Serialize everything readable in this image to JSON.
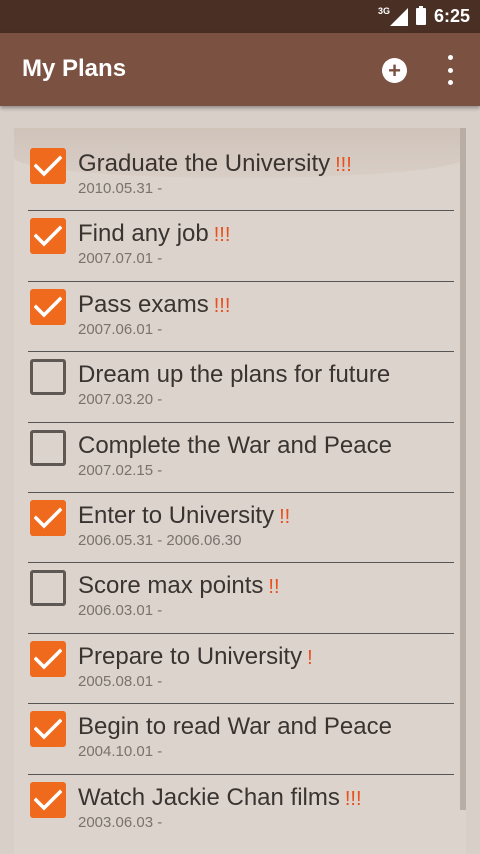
{
  "status_bar": {
    "network": "3G",
    "time": "6:25"
  },
  "app_bar": {
    "title": "My Plans"
  },
  "plans": [
    {
      "title": "Graduate the University",
      "priority": "!!!",
      "date": "2010.05.31 -",
      "checked": true
    },
    {
      "title": "Find any job",
      "priority": "!!!",
      "date": "2007.07.01 -",
      "checked": true
    },
    {
      "title": "Pass exams",
      "priority": "!!!",
      "date": "2007.06.01 -",
      "checked": true
    },
    {
      "title": "Dream up the plans for future",
      "priority": "",
      "date": "2007.03.20 -",
      "checked": false
    },
    {
      "title": "Complete the War and Peace",
      "priority": "",
      "date": "2007.02.15 -",
      "checked": false
    },
    {
      "title": "Enter to University",
      "priority": "!!",
      "date": "2006.05.31 - 2006.06.30",
      "checked": true
    },
    {
      "title": "Score max points",
      "priority": "!!",
      "date": "2006.03.01 -",
      "checked": false
    },
    {
      "title": "Prepare to University",
      "priority": "!",
      "date": "2005.08.01 -",
      "checked": true
    },
    {
      "title": "Begin to read War and Peace",
      "priority": "",
      "date": "2004.10.01 -",
      "checked": true
    },
    {
      "title": "Watch Jackie Chan films",
      "priority": "!!!",
      "date": "2003.06.03 -",
      "checked": true
    }
  ],
  "colors": {
    "accent": "#f06a1e",
    "app_bar": "#7b5141",
    "status_bar": "#4a2f24",
    "priority": "#e8501e"
  }
}
